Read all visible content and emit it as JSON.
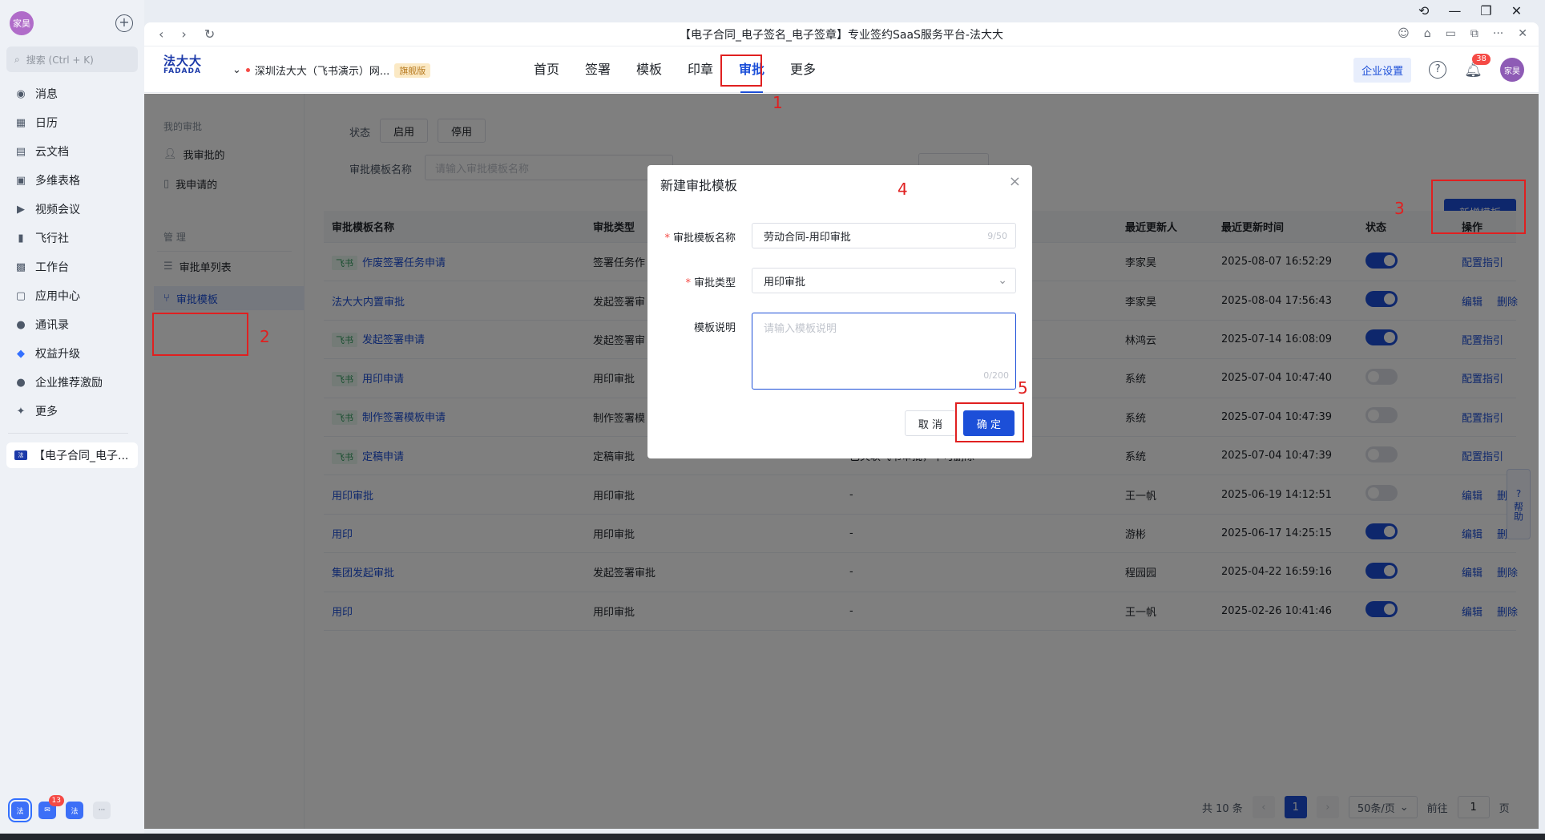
{
  "feishu": {
    "avatar": "家昊",
    "search_placeholder": "搜索 (Ctrl + K)",
    "nav": [
      {
        "label": "消息",
        "icon": "chat-icon"
      },
      {
        "label": "日历",
        "icon": "calendar-icon"
      },
      {
        "label": "云文档",
        "icon": "doc-icon"
      },
      {
        "label": "多维表格",
        "icon": "base-icon"
      },
      {
        "label": "视频会议",
        "icon": "video-icon"
      },
      {
        "label": "飞行社",
        "icon": "book-icon"
      },
      {
        "label": "工作台",
        "icon": "grid-icon"
      },
      {
        "label": "应用中心",
        "icon": "bag-icon"
      },
      {
        "label": "通讯录",
        "icon": "contacts-icon"
      },
      {
        "label": "权益升级",
        "icon": "diamond-icon"
      },
      {
        "label": "企业推荐激励",
        "icon": "person-icon"
      },
      {
        "label": "更多",
        "icon": "more-icon"
      }
    ],
    "open_tab": "【电子合同_电子...",
    "bottom_badge": "13"
  },
  "browser": {
    "title": "【电子合同_电子签名_电子签章】专业签约SaaS服务平台-法大大"
  },
  "header": {
    "logo_cn": "法大大",
    "logo_en": "FADADA",
    "org": "深圳法大大（飞书演示）网...",
    "edition": "旗舰版",
    "nav": [
      "首页",
      "签署",
      "模板",
      "印章",
      "审批",
      "更多"
    ],
    "active_nav": "审批",
    "corp_settings": "企业设置",
    "bell_badge": "38",
    "user": "家昊"
  },
  "leftnav": {
    "group1": "我的审批",
    "my_approvals": "我审批的",
    "my_requests": "我申请的",
    "group2": "管 理",
    "approval_list": "审批单列表",
    "approval_templates": "审批模板"
  },
  "filters": {
    "status_label": "状态",
    "enabled": "启用",
    "disabled": "停用",
    "name_label": "审批模板名称",
    "name_placeholder": "请输入审批模板名称"
  },
  "new_template_button": "新增模板",
  "table": {
    "headers": [
      "审批模板名称",
      "审批类型",
      "",
      "最近更新人",
      "最近更新时间",
      "状态",
      "操作"
    ],
    "tag": "飞书",
    "rows": [
      {
        "tag": true,
        "name": "作废签署任务申请",
        "type": "签署任务作",
        "note": "",
        "updater": "李家昊",
        "time": "2025-08-07 16:52:29",
        "on": true,
        "ops": [
          "配置指引"
        ]
      },
      {
        "tag": false,
        "name": "法大大内置审批",
        "type": "发起签署审",
        "note": "",
        "updater": "李家昊",
        "time": "2025-08-04 17:56:43",
        "on": true,
        "ops": [
          "编辑",
          "删除"
        ]
      },
      {
        "tag": true,
        "name": "发起签署申请",
        "type": "发起签署审",
        "note": "",
        "updater": "林鸿云",
        "time": "2025-07-14 16:08:09",
        "on": true,
        "ops": [
          "配置指引"
        ]
      },
      {
        "tag": true,
        "name": "用印申请",
        "type": "用印审批",
        "note": "",
        "updater": "系统",
        "time": "2025-07-04 10:47:40",
        "on": false,
        "ops": [
          "配置指引"
        ]
      },
      {
        "tag": true,
        "name": "制作签署模板申请",
        "type": "制作签署模",
        "note": "",
        "updater": "系统",
        "time": "2025-07-04 10:47:39",
        "on": false,
        "ops": [
          "配置指引"
        ]
      },
      {
        "tag": true,
        "name": "定稿申请",
        "type": "定稿审批",
        "note": "已关联飞书审批，不可删除",
        "updater": "系统",
        "time": "2025-07-04 10:47:39",
        "on": false,
        "ops": [
          "配置指引"
        ]
      },
      {
        "tag": false,
        "name": "用印审批",
        "type": "用印审批",
        "note": "-",
        "updater": "王一帆",
        "time": "2025-06-19 14:12:51",
        "on": false,
        "ops": [
          "编辑",
          "删除"
        ]
      },
      {
        "tag": false,
        "name": "用印",
        "type": "用印审批",
        "note": "-",
        "updater": "游彬",
        "time": "2025-06-17 14:25:15",
        "on": true,
        "ops": [
          "编辑",
          "删除"
        ]
      },
      {
        "tag": false,
        "name": "集团发起审批",
        "type": "发起签署审批",
        "note": "-",
        "updater": "程园园",
        "time": "2025-04-22 16:59:16",
        "on": true,
        "ops": [
          "编辑",
          "删除"
        ]
      },
      {
        "tag": false,
        "name": "用印",
        "type": "用印审批",
        "note": "-",
        "updater": "王一帆",
        "time": "2025-02-26 10:41:46",
        "on": true,
        "ops": [
          "编辑",
          "删除"
        ]
      }
    ]
  },
  "pager": {
    "total": "共 10 条",
    "current": "1",
    "page_size": "50条/页",
    "goto_label": "前往",
    "goto_value": "1",
    "page_unit": "页"
  },
  "help_float": "帮助",
  "modal": {
    "title": "新建审批模板",
    "name_label": "审批模板名称",
    "name_value": "劳动合同-用印审批",
    "name_count": "9/50",
    "type_label": "审批类型",
    "type_value": "用印审批",
    "desc_label": "模板说明",
    "desc_placeholder": "请输入模板说明",
    "desc_count": "0/200",
    "cancel": "取 消",
    "ok": "确 定"
  },
  "annotations": [
    "1",
    "2",
    "3",
    "4",
    "5"
  ],
  "colors": {
    "primary": "#1c4fd8",
    "annotation": "#e02020",
    "tag_green": "#2e9b5c"
  }
}
